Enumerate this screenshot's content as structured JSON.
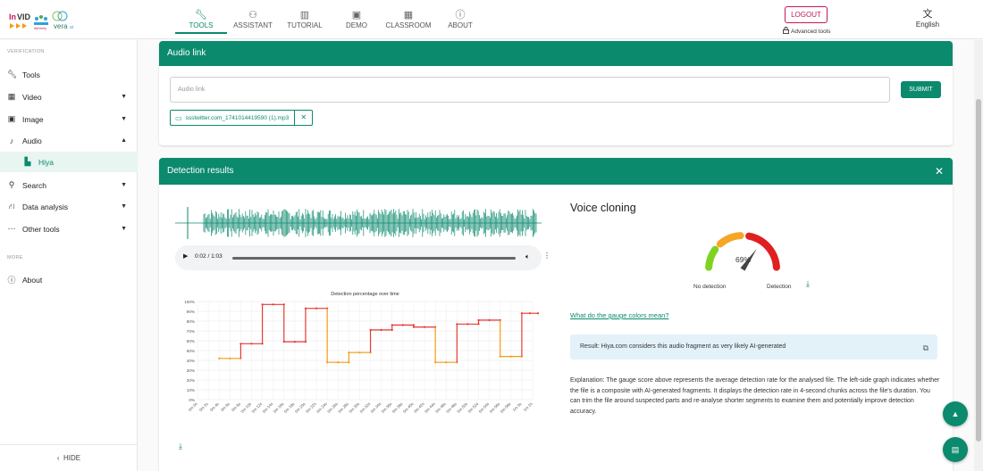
{
  "header": {
    "logo_text": "InVID WeVerify vera.ai",
    "nav": [
      {
        "label": "TOOLS",
        "icon": "wrench-icon",
        "active": true
      },
      {
        "label": "ASSISTANT",
        "icon": "assistant-icon",
        "active": false
      },
      {
        "label": "TUTORIAL",
        "icon": "book-icon",
        "active": false
      },
      {
        "label": "DEMO",
        "icon": "demo-icon",
        "active": false
      },
      {
        "label": "CLASSROOM",
        "icon": "classroom-icon",
        "active": false
      },
      {
        "label": "ABOUT",
        "icon": "info-icon",
        "active": false
      }
    ],
    "logout_label": "LOGOUT",
    "advanced_tools_label": "Advanced tools",
    "language_label": "English",
    "accent_color": "#0b8a6e",
    "logout_color": "#c2185b"
  },
  "sidebar": {
    "section_verification": "VERIFICATION",
    "items": [
      {
        "label": "Tools",
        "icon": "wrench-icon"
      },
      {
        "label": "Video",
        "icon": "video-icon"
      },
      {
        "label": "Image",
        "icon": "image-icon"
      },
      {
        "label": "Audio",
        "icon": "music-note-icon"
      },
      {
        "label": "Hiya",
        "icon": "hiya-icon"
      },
      {
        "label": "Search",
        "icon": "search-icon"
      },
      {
        "label": "Data analysis",
        "icon": "data-analysis-icon"
      },
      {
        "label": "Other tools",
        "icon": "more-icon"
      }
    ],
    "section_more": "MORE",
    "about_label": "About",
    "hide_label": "HIDE"
  },
  "audio_link": {
    "title": "Audio link",
    "input_placeholder": "Audio link",
    "submit_label": "SUBMIT",
    "file_name": "ssstwitter.com_1741014419590 (1).mp3"
  },
  "detection": {
    "title": "Detection results",
    "player_time": "0:02 / 1:03",
    "voice_cloning_title": "Voice cloning",
    "gauge_percent": "69%",
    "gauge_value": 69,
    "no_detection_label": "No detection",
    "detection_label": "Detection",
    "gauge_colors_link": "What do the gauge colors mean?",
    "result_text": "Result: Hiya.com considers this audio fragment as very likely AI-generated",
    "explanation": "Explanation: The gauge score above represents the average detection rate for the analysed file. The left-side graph indicates whether the file is a composite with AI-generated fragments. It displays the detection rate in 4-second chunks across the file's duration. You can trim the file around suspected parts and re-analyse shorter segments to examine them and potentially improve detection accuracy."
  },
  "chart_data": {
    "type": "line",
    "title": "Detection percentage over time",
    "step": true,
    "ylim": [
      0,
      100
    ],
    "y_ticks": [
      "0%",
      "10%",
      "20%",
      "30%",
      "40%",
      "50%",
      "60%",
      "70%",
      "80%",
      "90%",
      "100%"
    ],
    "x": [
      "0m 0s",
      "0m 2s",
      "0m 4s",
      "0m 6s",
      "0m 8s",
      "0m 10s",
      "0m 12s",
      "0m 14s",
      "0m 16s",
      "0m 18s",
      "0m 20s",
      "0m 22s",
      "0m 24s",
      "0m 26s",
      "0m 28s",
      "0m 30s",
      "0m 32s",
      "0m 34s",
      "0m 36s",
      "0m 38s",
      "0m 40s",
      "0m 42s",
      "0m 44s",
      "0m 46s",
      "0m 48s",
      "0m 50s",
      "0m 52s",
      "0m 54s",
      "0m 56s",
      "0m 58s",
      "1m 0s",
      "1m 2s"
    ],
    "values": [
      null,
      null,
      42,
      42,
      42,
      57,
      57,
      57,
      97,
      97,
      97,
      59,
      59,
      59,
      93,
      93,
      93,
      38,
      38,
      38,
      48,
      48,
      48,
      71,
      71,
      71,
      76,
      76,
      76,
      74,
      74,
      74,
      38,
      38,
      38,
      77,
      77,
      77,
      81,
      81,
      81,
      44,
      44,
      44,
      88,
      88,
      88
    ],
    "segments": [
      {
        "start": "0m 4s",
        "end": "0m 8s",
        "value": 42
      },
      {
        "start": "0m 8s",
        "end": "0m 12s",
        "value": 57
      },
      {
        "start": "0m 12s",
        "end": "0m 16s",
        "value": 97
      },
      {
        "start": "0m 16s",
        "end": "0m 20s",
        "value": 59
      },
      {
        "start": "0m 20s",
        "end": "0m 24s",
        "value": 93
      },
      {
        "start": "0m 24s",
        "end": "0m 28s",
        "value": 38
      },
      {
        "start": "0m 28s",
        "end": "0m 32s",
        "value": 48
      },
      {
        "start": "0m 32s",
        "end": "0m 36s",
        "value": 71
      },
      {
        "start": "0m 36s",
        "end": "0m 40s",
        "value": 76
      },
      {
        "start": "0m 40s",
        "end": "0m 44s",
        "value": 74
      },
      {
        "start": "0m 44s",
        "end": "0m 48s",
        "value": 38
      },
      {
        "start": "0m 48s",
        "end": "0m 52s",
        "value": 77
      },
      {
        "start": "0m 52s",
        "end": "0m 56s",
        "value": 81
      },
      {
        "start": "0m 56s",
        "end": "1m 0s",
        "value": 44
      },
      {
        "start": "1m 0s",
        "end": "1m 3s",
        "value": 88
      }
    ],
    "grid": true,
    "colors": {
      "high": "#e53935",
      "low": "#f39c12"
    }
  }
}
